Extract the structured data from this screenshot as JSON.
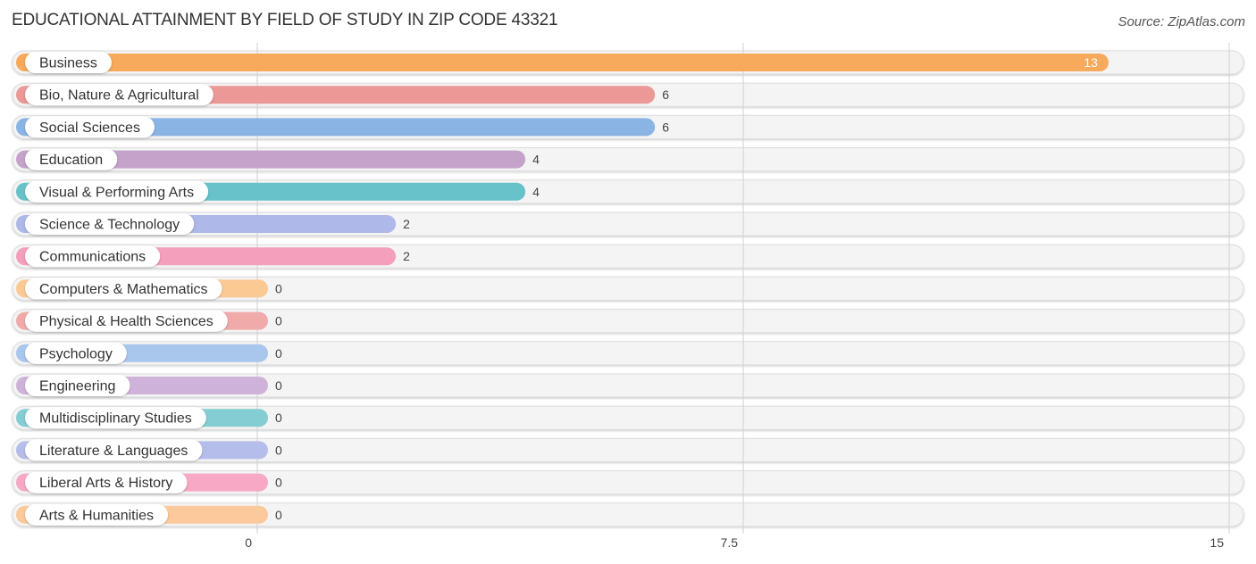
{
  "chart_data": {
    "type": "bar",
    "orientation": "horizontal",
    "title": "EDUCATIONAL ATTAINMENT BY FIELD OF STUDY IN ZIP CODE 43321",
    "source": "Source: ZipAtlas.com",
    "xlabel": "",
    "ylabel": "",
    "xlim": [
      0,
      15
    ],
    "x_ticks": [
      0,
      7.5,
      15
    ],
    "x_tick_labels": [
      "0",
      "7.5",
      "15"
    ],
    "grid": true,
    "categories": [
      "Business",
      "Bio, Nature & Agricultural",
      "Social Sciences",
      "Education",
      "Visual & Performing Arts",
      "Science & Technology",
      "Communications",
      "Computers & Mathematics",
      "Physical & Health Sciences",
      "Psychology",
      "Engineering",
      "Multidisciplinary Studies",
      "Literature & Languages",
      "Liberal Arts & History",
      "Arts & Humanities"
    ],
    "values": [
      13,
      6,
      6,
      4,
      4,
      2,
      2,
      0,
      0,
      0,
      0,
      0,
      0,
      0,
      0
    ],
    "colors": [
      "#f7a95c",
      "#eb9896",
      "#8ab4e3",
      "#c4a2c9",
      "#67c2c9",
      "#aeb8e9",
      "#f49fbb",
      "#fbc994",
      "#f0aaaa",
      "#a9c6ec",
      "#cfb2d9",
      "#84cdd2",
      "#b5bdeb",
      "#f6a8c4",
      "#fbc99c"
    ]
  }
}
